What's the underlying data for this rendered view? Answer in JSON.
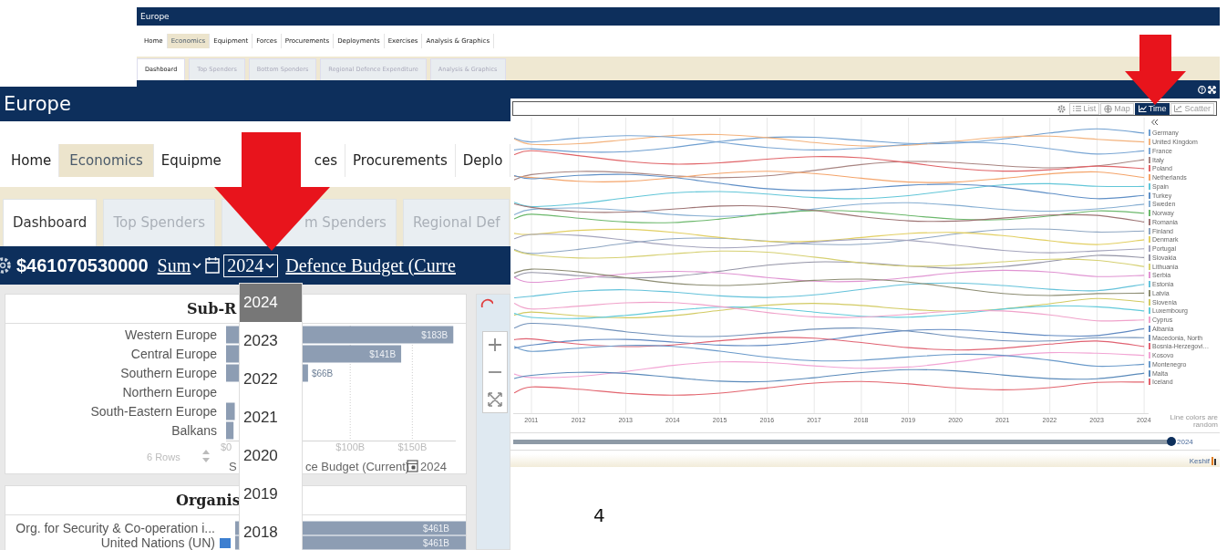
{
  "back_window": {
    "title": "Europe",
    "nav": [
      {
        "label": "Home",
        "selected": false
      },
      {
        "label": "Economics",
        "selected": true
      },
      {
        "label": "Equipment",
        "selected": false
      },
      {
        "label": "Forces",
        "selected": false
      },
      {
        "label": "Procurements",
        "selected": false
      },
      {
        "label": "Deployments",
        "selected": false
      },
      {
        "label": "Exercises",
        "selected": false
      },
      {
        "label": "Analysis & Graphics",
        "selected": false
      }
    ],
    "tabs": [
      {
        "label": "Dashboard",
        "selected": true
      },
      {
        "label": "Top Spenders",
        "selected": false
      },
      {
        "label": "Bottom Spenders",
        "selected": false
      },
      {
        "label": "Regional Defence Expenditure",
        "selected": false
      },
      {
        "label": "Analysis & Graphics",
        "selected": false
      }
    ],
    "chart_panel": {
      "views": [
        {
          "kind": "list",
          "label": "List",
          "selected": false
        },
        {
          "kind": "map",
          "label": "Map",
          "selected": false
        },
        {
          "kind": "time",
          "label": "Time",
          "selected": true
        },
        {
          "kind": "scatter",
          "label": "Scatter",
          "selected": false
        }
      ],
      "legend": [
        {
          "name": "Germany",
          "color": "#6f9fd0"
        },
        {
          "name": "United Kingdom",
          "color": "#f3b27c"
        },
        {
          "name": "France",
          "color": "#7aa6d4"
        },
        {
          "name": "Italy",
          "color": "#a88582"
        },
        {
          "name": "Poland",
          "color": "#e06468"
        },
        {
          "name": "Netherlands",
          "color": "#f4a46a"
        },
        {
          "name": "Spain",
          "color": "#62c6d8"
        },
        {
          "name": "Turkey",
          "color": "#5f8fc6"
        },
        {
          "name": "Sweden",
          "color": "#86aed2"
        },
        {
          "name": "Norway",
          "color": "#6cb86c"
        },
        {
          "name": "Romania",
          "color": "#9e7474"
        },
        {
          "name": "Finland",
          "color": "#8ea6c2"
        },
        {
          "name": "Denmark",
          "color": "#e2cf62"
        },
        {
          "name": "Portugal",
          "color": "#a4a4bc"
        },
        {
          "name": "Slovakia",
          "color": "#9494a6"
        },
        {
          "name": "Lithuania",
          "color": "#d6d072"
        },
        {
          "name": "Serbia",
          "color": "#e094d2"
        },
        {
          "name": "Estonia",
          "color": "#64c2da"
        },
        {
          "name": "Latvia",
          "color": "#8c8c72"
        },
        {
          "name": "Slovenia",
          "color": "#d2ca62"
        },
        {
          "name": "Luxembourg",
          "color": "#62cada"
        },
        {
          "name": "Cyprus",
          "color": "#f0a2ca"
        },
        {
          "name": "Albania",
          "color": "#628ac2"
        },
        {
          "name": "Macedonia, North",
          "color": "#7292ba"
        },
        {
          "name": "Bosnia-Herzegovi…",
          "color": "#e06272"
        },
        {
          "name": "Kosovo",
          "color": "#f2a4d4"
        },
        {
          "name": "Montenegro",
          "color": "#6a9aca"
        },
        {
          "name": "Malta",
          "color": "#5a8aba"
        },
        {
          "name": "Iceland",
          "color": "#e2646e"
        }
      ],
      "x_ticks": [
        "2011",
        "2012",
        "2013",
        "2014",
        "2015",
        "2016",
        "2017",
        "2018",
        "2019",
        "2020",
        "2021",
        "2022",
        "2023",
        "2024"
      ],
      "note": "Line colors are random",
      "slider": {
        "level": 1,
        "label": "2024"
      },
      "footer": "Keshif"
    }
  },
  "front_window": {
    "title": "Europe",
    "nav": [
      {
        "label": "Home",
        "selected": false
      },
      {
        "label": "Economics",
        "selected": true
      },
      {
        "label": "Equipme",
        "selected": false
      },
      {
        "label": "ces",
        "selected": false
      },
      {
        "label": "Procurements",
        "selected": false
      },
      {
        "label": "Deplo",
        "selected": false
      }
    ],
    "tabs": [
      {
        "label": "Dashboard",
        "selected": true
      },
      {
        "label": "Top Spenders",
        "selected": false
      },
      {
        "label": "m Spenders",
        "selected": false
      },
      {
        "label": "Regional Def",
        "selected": false
      }
    ],
    "toolbar": {
      "total": "$461070530000",
      "aggregate": "Sum",
      "year": "2024",
      "measure": "Defence Budget (Curre"
    },
    "year_menu": [
      {
        "label": "2024",
        "selected": true
      },
      {
        "label": "2023",
        "selected": false
      },
      {
        "label": "2022",
        "selected": false
      },
      {
        "label": "2021",
        "selected": false
      },
      {
        "label": "2020",
        "selected": false
      },
      {
        "label": "2019",
        "selected": false
      },
      {
        "label": "2018",
        "selected": false
      }
    ],
    "subregion_panel": {
      "title": "Sub-R",
      "chart_data": {
        "type": "bar",
        "orientation": "horizontal",
        "categories": [
          "Western Europe",
          "Central Europe",
          "Southern Europe",
          "Northern Europe",
          "South-Eastern Europe",
          "Balkans"
        ],
        "values": [
          183,
          141,
          66,
          null,
          7,
          6
        ],
        "xlim": [
          0,
          185
        ],
        "xticks": [
          {
            "value": 0,
            "label": "$0"
          },
          {
            "value": 100,
            "label": "$100B"
          },
          {
            "value": 150,
            "label": "$150B"
          }
        ],
        "value_labels": [
          "$183B",
          "$141B",
          "$66B",
          null,
          null,
          null
        ]
      },
      "rows_label": "6 Rows",
      "axis_title_start": "S",
      "axis_title_end": "ce Budget (Current)",
      "axis_year": "2024"
    },
    "organisation_panel": {
      "title": "Organis",
      "rows": [
        {
          "kind": "plain",
          "name": "Org. for Security & Co-operation i...",
          "value": "$461B"
        },
        {
          "kind": "tagged",
          "name": "United Nations (UN)",
          "value": "$461B"
        }
      ]
    }
  },
  "page_number": "4"
}
